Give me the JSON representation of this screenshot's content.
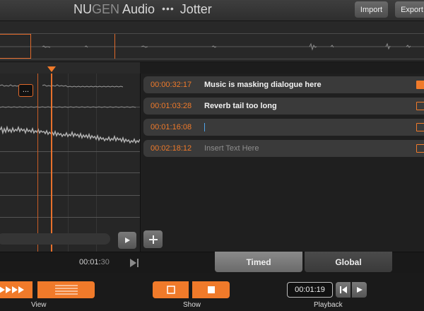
{
  "header": {
    "brand_nu": "NU",
    "brand_gen": "GEN",
    "brand_audio": " Audio",
    "brand_dots": "•••",
    "app_name": "Jotter",
    "import_label": "Import",
    "export_label": "Export"
  },
  "track": {
    "marker_label": "..."
  },
  "notes": [
    {
      "time": "00:00:32:17",
      "text": "Music is masking dialogue here",
      "checked": true
    },
    {
      "time": "00:01:03:28",
      "text": "Reverb tail too long",
      "checked": false
    },
    {
      "time": "00:01:16:08",
      "text": "",
      "checked": false,
      "editing": true
    },
    {
      "time": "00:02:18:12",
      "text": "Insert Text Here",
      "checked": false,
      "placeholder": true
    }
  ],
  "timebar": {
    "time_main": "00:01:",
    "time_dim": "30"
  },
  "tabs": {
    "timed": "Timed",
    "global": "Global",
    "active": "timed"
  },
  "footer": {
    "view_label": "View",
    "show_label": "Show",
    "playback_label": "Playback",
    "playback_time": "00:01:19"
  },
  "colors": {
    "accent": "#f07a2a",
    "background": "#1c1c1c"
  }
}
